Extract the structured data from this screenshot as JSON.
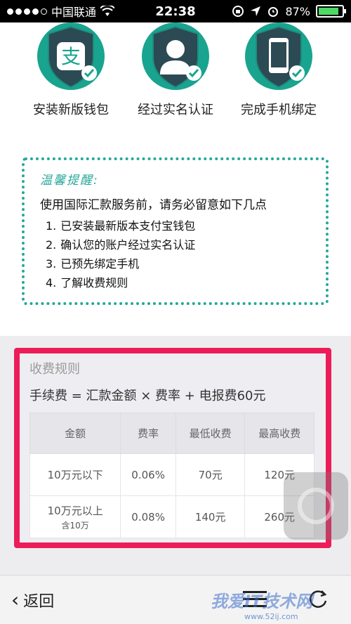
{
  "status_bar": {
    "carrier": "中国联通",
    "time": "22:38",
    "battery": "87%",
    "battery_level": 0.87,
    "icons": [
      "wifi-icon",
      "rotation-lock-icon",
      "location-arrow-icon",
      "alarm-icon",
      "battery-icon"
    ]
  },
  "badges": [
    {
      "label": "安装新版钱包",
      "icon": "alipay-wallet-icon",
      "glyph": "支"
    },
    {
      "label": "经过实名认证",
      "icon": "user-verified-icon"
    },
    {
      "label": "完成手机绑定",
      "icon": "phone-bound-icon"
    }
  ],
  "tips": {
    "title": "温馨提醒:",
    "intro": "使用国际汇款服务前，请务必留意如下几点",
    "items": [
      {
        "num": "1.",
        "text": "已安装最新版本支付宝钱包"
      },
      {
        "num": "2.",
        "text": "确认您的账户经过实名认证"
      },
      {
        "num": "3.",
        "text": "已预先绑定手机"
      },
      {
        "num": "4.",
        "text": "了解收费规则"
      }
    ]
  },
  "fees": {
    "title": "收费规则",
    "formula": "手续费 = 汇款金额 × 费率 + 电报费60元",
    "headers": [
      "金额",
      "费率",
      "最低收费",
      "最高收费"
    ],
    "rows": [
      {
        "amount": "10万元以下",
        "amount_sub": "",
        "rate": "0.06%",
        "min": "70元",
        "max": "120元"
      },
      {
        "amount": "10万元以上",
        "amount_sub": "含10万",
        "rate": "0.08%",
        "min": "140元",
        "max": "260元"
      }
    ]
  },
  "bottom_bar": {
    "back_label": "返回"
  },
  "watermark": {
    "text": "我爱IT技术网",
    "url": "www.52ij.com"
  },
  "colors": {
    "accent_teal": "#19a48f",
    "highlight_red": "#ec1c59",
    "battery_green": "#4cd964"
  }
}
